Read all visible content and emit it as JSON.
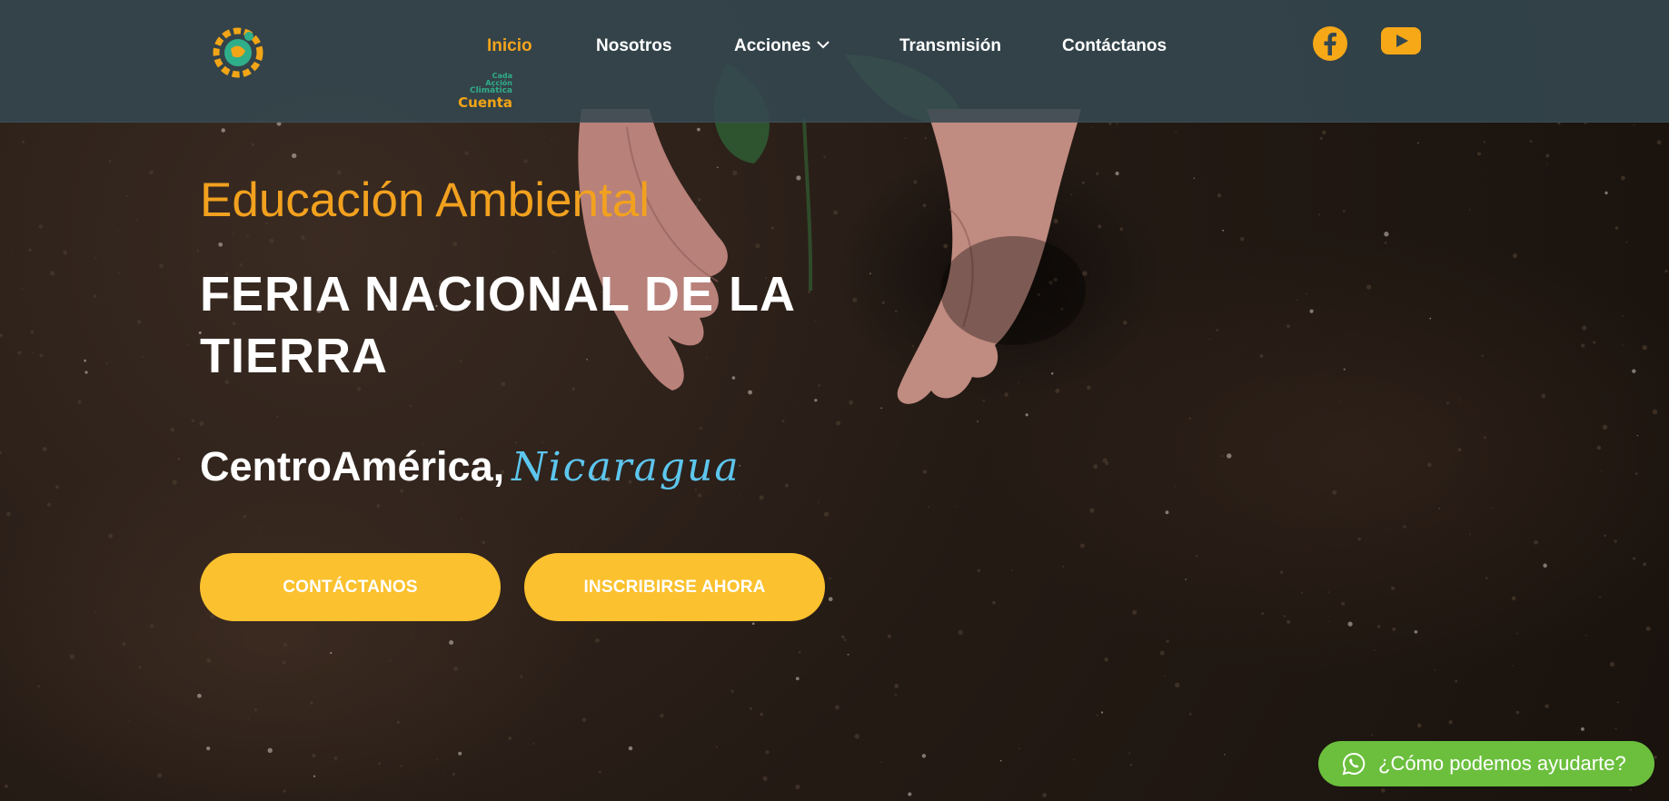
{
  "brand": {
    "logo_lines": [
      "Cada",
      "Acción",
      "Climática",
      "Cuenta"
    ],
    "colors": {
      "teal": "#2fae8a",
      "orange": "#f2a516"
    }
  },
  "nav": {
    "items": [
      {
        "label": "Inicio",
        "active": true
      },
      {
        "label": "Nosotros"
      },
      {
        "label": "Acciones",
        "has_dropdown": true
      },
      {
        "label": "Transmisión"
      },
      {
        "label": "Contáctanos"
      }
    ],
    "active_color": "#f3a41b"
  },
  "social": {
    "icons": [
      "facebook-icon",
      "youtube-icon"
    ],
    "color": "#f7a817"
  },
  "hero": {
    "eyebrow": "Educación Ambiental",
    "headline": "FERIA NACIONAL DE LA TIERRA",
    "location_prefix": "CentroAmérica,",
    "location_script": "Nicaragua",
    "buttons": {
      "contact": "CONTÁCTANOS",
      "signup": "INSCRIBIRSE AHORA"
    },
    "button_color": "#fbc12e"
  },
  "whatsapp": {
    "label": "¿Cómo podemos ayudarte?",
    "icon": "whatsapp-icon",
    "color": "#6bbf3d"
  }
}
